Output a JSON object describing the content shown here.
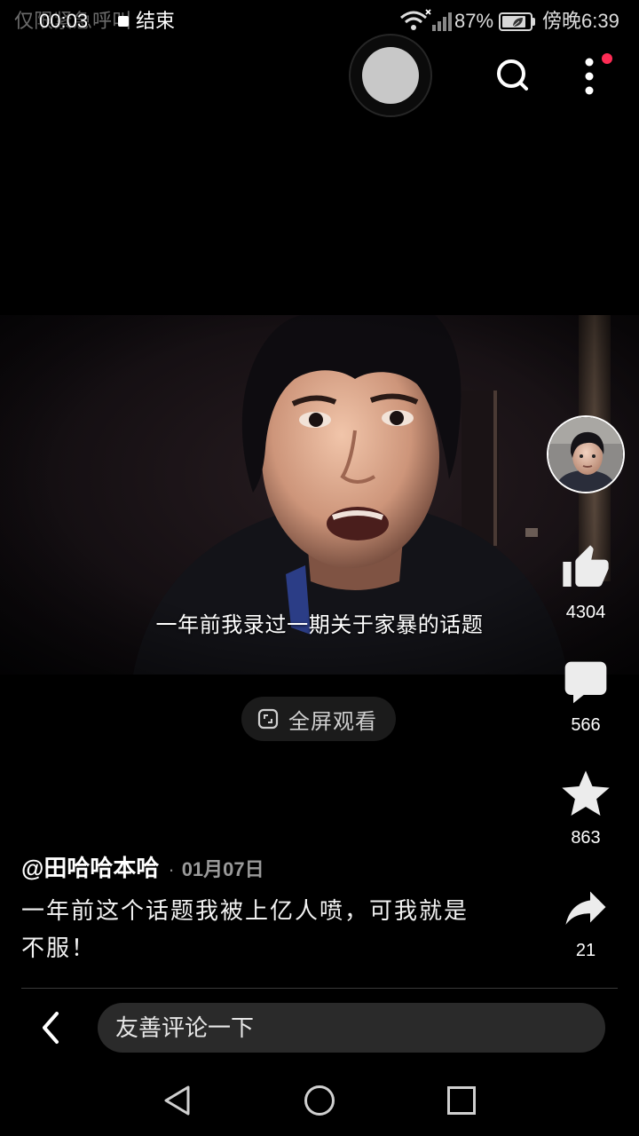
{
  "status_bar": {
    "carrier_text": "仅限紧急呼叫",
    "recording_time": "00:03",
    "recording_end": "结束",
    "battery_percent": "87%",
    "time": "傍晚6:39"
  },
  "header": {
    "search_icon": "search-icon",
    "more_icon": "more-vertical-icon",
    "notification_dot_color": "#fe2c55"
  },
  "video": {
    "subtitle": "一年前我录过一期关于家暴的话题",
    "fullscreen_icon": "fullscreen-icon",
    "fullscreen_label": "全屏观看"
  },
  "actions": {
    "avatar_icon": "author-avatar",
    "like_icon": "thumb-up-icon",
    "like_count": "4304",
    "comment_icon": "comment-bubble-icon",
    "comment_count": "566",
    "favorite_icon": "star-icon",
    "favorite_count": "863",
    "share_icon": "share-arrow-icon",
    "share_count": "21"
  },
  "post": {
    "author": "@田哈哈本哈",
    "date_separator": "·",
    "date": "01月07日",
    "description": "一年前这个话题我被上亿人喷，可我就是不服！"
  },
  "comment_bar": {
    "back_icon": "chevron-left-icon",
    "placeholder": "友善评论一下"
  },
  "nav_bar": {
    "icons": [
      "back-triangle-icon",
      "home-circle-icon",
      "recents-square-icon"
    ]
  },
  "colors": {
    "background": "#000000",
    "accent_dot": "#fe2c55",
    "input_background": "#2a2a2a",
    "secondary_text": "#9a9a9a"
  }
}
